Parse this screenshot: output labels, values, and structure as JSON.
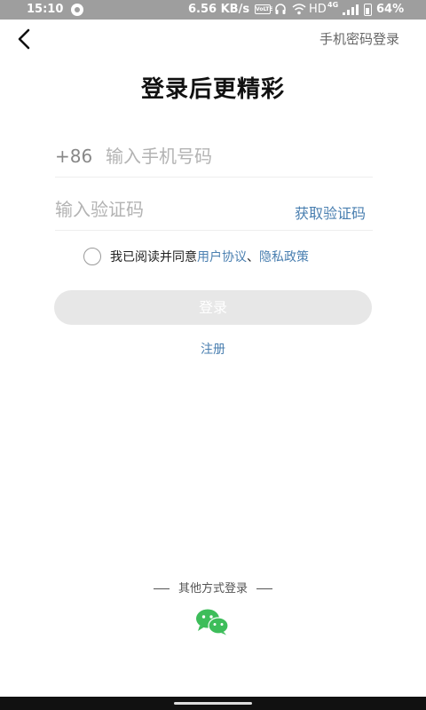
{
  "status_bar": {
    "time": "15:10",
    "net_speed": "6.56 KB/s",
    "volte": "VoLTE",
    "hd": "HD",
    "network": "4G",
    "battery": "64%"
  },
  "header": {
    "back_icon": "chevron-left-icon",
    "password_login": "手机密码登录"
  },
  "title": "登录后更精彩",
  "form": {
    "phone_prefix": "+86",
    "phone_placeholder": "输入手机号码",
    "phone_value": "",
    "code_placeholder": "输入验证码",
    "code_value": "",
    "get_code": "获取验证码",
    "agree_prefix": "我已阅读并同意",
    "user_agreement": "用户协议",
    "separator": "、",
    "privacy_policy": "隐私政策",
    "agree_checked": false,
    "login_button": "登录",
    "register": "注册"
  },
  "other_login": {
    "label": "其他方式登录",
    "wechat_icon": "wechat-icon"
  },
  "colors": {
    "link": "#4a7fb0",
    "wechat": "#3dbd5a",
    "login_button_disabled": "#e7e7e7",
    "status_bar": "#9e9e9e"
  }
}
